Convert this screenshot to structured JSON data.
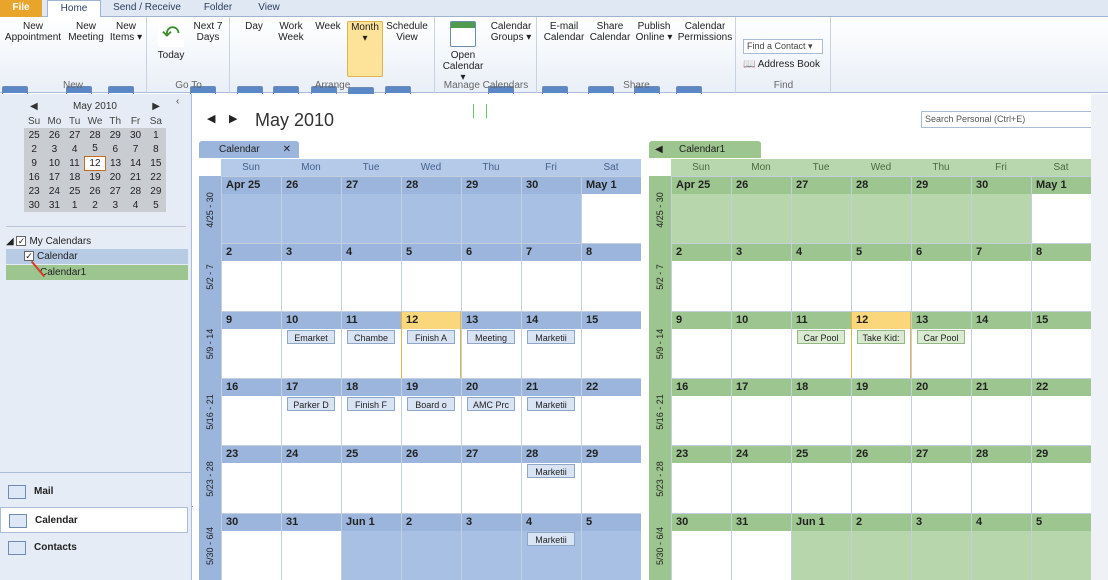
{
  "tabs": [
    "File",
    "Home",
    "Send / Receive",
    "Folder",
    "View"
  ],
  "groups": {
    "new": {
      "label": "New",
      "buttons": [
        "New Appointment",
        "New Meeting",
        "New Items"
      ]
    },
    "goto": {
      "label": "Go To",
      "buttons": [
        "Today",
        "Next 7 Days"
      ]
    },
    "arrange": {
      "label": "Arrange",
      "buttons": [
        "Day",
        "Work Week",
        "Week",
        "Month",
        "Schedule View"
      ]
    },
    "manage": {
      "label": "Manage Calendars",
      "buttons": [
        "Open Calendar",
        "Calendar Groups"
      ]
    },
    "share": {
      "label": "Share",
      "buttons": [
        "E-mail Calendar",
        "Share Calendar",
        "Publish Online",
        "Calendar Permissions"
      ]
    },
    "find": {
      "label": "Find",
      "find_contact": "Find a Contact",
      "address_book": "Address Book"
    }
  },
  "mini": {
    "month": "May 2010",
    "days": [
      "Su",
      "Mo",
      "Tu",
      "We",
      "Th",
      "Fr",
      "Sa"
    ],
    "weeks": [
      [
        "25",
        "26",
        "27",
        "28",
        "29",
        "30",
        "1"
      ],
      [
        "2",
        "3",
        "4",
        "5",
        "6",
        "7",
        "8"
      ],
      [
        "9",
        "10",
        "11",
        "12",
        "13",
        "14",
        "15"
      ],
      [
        "16",
        "17",
        "18",
        "19",
        "20",
        "21",
        "22"
      ],
      [
        "23",
        "24",
        "25",
        "26",
        "27",
        "28",
        "29"
      ],
      [
        "30",
        "31",
        "1",
        "2",
        "3",
        "4",
        "5"
      ]
    ]
  },
  "my_calendars": {
    "label": "My Calendars",
    "items": [
      "Calendar",
      "Calendar1"
    ]
  },
  "nav": [
    "Mail",
    "Calendar",
    "Contacts"
  ],
  "main": {
    "title": "May 2010",
    "search_placeholder": "Search Personal (Ctrl+E)"
  },
  "calendars": [
    {
      "tab": "Calendar",
      "accent": "#9bb5dc",
      "days": [
        "Sun",
        "Mon",
        "Tue",
        "Wed",
        "Thu",
        "Fri",
        "Sat"
      ],
      "week_labels": [
        "4/25 - 30",
        "5/2 - 7",
        "5/9 - 14",
        "5/16 - 21",
        "5/23 - 28",
        "5/30 - 6/4"
      ],
      "dates": [
        [
          "Apr 25",
          "26",
          "27",
          "28",
          "29",
          "30",
          "May 1"
        ],
        [
          "2",
          "3",
          "4",
          "5",
          "6",
          "7",
          "8"
        ],
        [
          "9",
          "10",
          "11",
          "12",
          "13",
          "14",
          "15"
        ],
        [
          "16",
          "17",
          "18",
          "19",
          "20",
          "21",
          "22"
        ],
        [
          "23",
          "24",
          "25",
          "26",
          "27",
          "28",
          "29"
        ],
        [
          "30",
          "31",
          "Jun 1",
          "2",
          "3",
          "4",
          "5"
        ]
      ],
      "events": [
        [
          2,
          1,
          "Emarket"
        ],
        [
          2,
          2,
          "Chambe"
        ],
        [
          2,
          3,
          "Finish A"
        ],
        [
          2,
          4,
          "Meeting"
        ],
        [
          2,
          5,
          "Marketii"
        ],
        [
          3,
          1,
          "Parker D"
        ],
        [
          3,
          2,
          "Finish F"
        ],
        [
          3,
          3,
          "Board o"
        ],
        [
          3,
          4,
          "AMC Prc"
        ],
        [
          3,
          5,
          "Marketii"
        ],
        [
          4,
          5,
          "Marketii"
        ],
        [
          5,
          5,
          "Marketii"
        ]
      ]
    },
    {
      "tab": "Calendar1",
      "accent": "#9cc58f",
      "days": [
        "Sun",
        "Mon",
        "Tue",
        "Wed",
        "Thu",
        "Fri",
        "Sat"
      ],
      "week_labels": [
        "4/25 - 30",
        "5/2 - 7",
        "5/9 - 14",
        "5/16 - 21",
        "5/23 - 28",
        "5/30 - 6/4"
      ],
      "dates": [
        [
          "Apr 25",
          "26",
          "27",
          "28",
          "29",
          "30",
          "May 1"
        ],
        [
          "2",
          "3",
          "4",
          "5",
          "6",
          "7",
          "8"
        ],
        [
          "9",
          "10",
          "11",
          "12",
          "13",
          "14",
          "15"
        ],
        [
          "16",
          "17",
          "18",
          "19",
          "20",
          "21",
          "22"
        ],
        [
          "23",
          "24",
          "25",
          "26",
          "27",
          "28",
          "29"
        ],
        [
          "30",
          "31",
          "Jun 1",
          "2",
          "3",
          "4",
          "5"
        ]
      ],
      "events": [
        [
          2,
          2,
          "Car Pool"
        ],
        [
          2,
          3,
          "Take Kid:"
        ],
        [
          2,
          4,
          "Car Pool"
        ]
      ]
    }
  ]
}
